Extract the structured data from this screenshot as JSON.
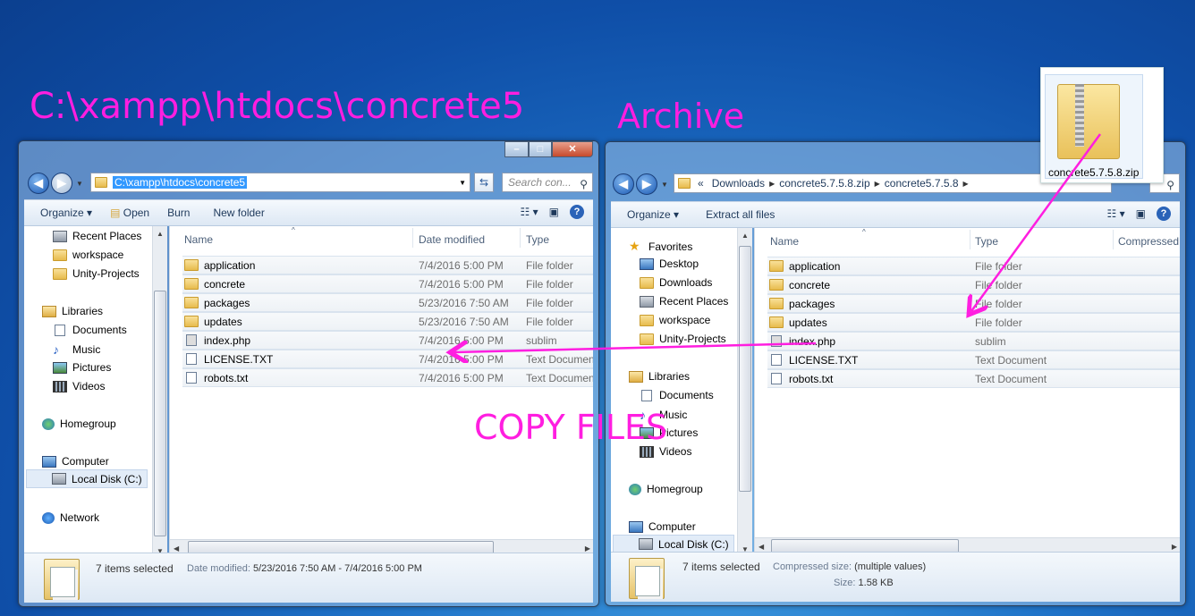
{
  "annotations": {
    "left_path": "C:\\xampp\\htdocs\\concrete5",
    "archive": "Archive",
    "copy_files": "COPY FILES"
  },
  "zip_desktop_icon": {
    "label": "concrete5.7.5.8.zip",
    "icon": "zip-folder-icon"
  },
  "left_window": {
    "address": "C:\\xampp\\htdocs\\concrete5",
    "search_placeholder": "Search con...",
    "toolbar": {
      "organize": "Organize",
      "open": "Open",
      "burn": "Burn",
      "new_folder": "New folder"
    },
    "nav": [
      {
        "label": "Recent Places",
        "icon": "recent-places-icon"
      },
      {
        "label": "workspace",
        "icon": "folder-icon"
      },
      {
        "label": "Unity-Projects",
        "icon": "folder-icon"
      },
      {
        "label": "Libraries",
        "icon": "libraries-icon"
      },
      {
        "label": "Documents",
        "icon": "documents-icon"
      },
      {
        "label": "Music",
        "icon": "music-icon"
      },
      {
        "label": "Pictures",
        "icon": "pictures-icon"
      },
      {
        "label": "Videos",
        "icon": "videos-icon"
      },
      {
        "label": "Homegroup",
        "icon": "homegroup-icon"
      },
      {
        "label": "Computer",
        "icon": "computer-icon"
      },
      {
        "label": "Local Disk (C:)",
        "icon": "local-disk-icon"
      },
      {
        "label": "Network",
        "icon": "network-icon"
      }
    ],
    "columns": {
      "name": "Name",
      "date": "Date modified",
      "type": "Type"
    },
    "files": [
      {
        "name": "application",
        "date": "7/4/2016 5:00 PM",
        "type": "File folder"
      },
      {
        "name": "concrete",
        "date": "7/4/2016 5:00 PM",
        "type": "File folder"
      },
      {
        "name": "packages",
        "date": "5/23/2016 7:50 AM",
        "type": "File folder"
      },
      {
        "name": "updates",
        "date": "5/23/2016 7:50 AM",
        "type": "File folder"
      },
      {
        "name": "index.php",
        "date": "7/4/2016 5:00 PM",
        "type": "sublim"
      },
      {
        "name": "LICENSE.TXT",
        "date": "7/4/2016 5:00 PM",
        "type": "Text Documen"
      },
      {
        "name": "robots.txt",
        "date": "7/4/2016 5:00 PM",
        "type": "Text Documen"
      }
    ],
    "status": {
      "selected": "7 items selected",
      "date_label": "Date modified:",
      "date_value": "5/23/2016 7:50 AM - 7/4/2016 5:00 PM"
    }
  },
  "right_window": {
    "breadcrumb": [
      "«",
      "Downloads",
      "concrete5.7.5.8.zip",
      "concrete5.7.5.8"
    ],
    "toolbar": {
      "organize": "Organize",
      "extract": "Extract all files"
    },
    "nav": [
      {
        "label": "Favorites",
        "icon": "favorites-star-icon"
      },
      {
        "label": "Desktop",
        "icon": "desktop-icon"
      },
      {
        "label": "Downloads",
        "icon": "downloads-icon"
      },
      {
        "label": "Recent Places",
        "icon": "recent-places-icon"
      },
      {
        "label": "workspace",
        "icon": "folder-icon"
      },
      {
        "label": "Unity-Projects",
        "icon": "folder-icon"
      },
      {
        "label": "Libraries",
        "icon": "libraries-icon"
      },
      {
        "label": "Documents",
        "icon": "documents-icon"
      },
      {
        "label": "Music",
        "icon": "music-icon"
      },
      {
        "label": "Pictures",
        "icon": "pictures-icon"
      },
      {
        "label": "Videos",
        "icon": "videos-icon"
      },
      {
        "label": "Homegroup",
        "icon": "homegroup-icon"
      },
      {
        "label": "Computer",
        "icon": "computer-icon"
      },
      {
        "label": "Local Disk (C:)",
        "icon": "local-disk-icon"
      }
    ],
    "columns": {
      "name": "Name",
      "type": "Type",
      "compressed": "Compressed"
    },
    "files": [
      {
        "name": "application",
        "type": "File folder"
      },
      {
        "name": "concrete",
        "type": "File folder"
      },
      {
        "name": "packages",
        "type": "File folder"
      },
      {
        "name": "updates",
        "type": "File folder"
      },
      {
        "name": "index.php",
        "type": "sublim"
      },
      {
        "name": "LICENSE.TXT",
        "type": "Text Document"
      },
      {
        "name": "robots.txt",
        "type": "Text Document"
      }
    ],
    "status": {
      "selected": "7 items selected",
      "csize_label": "Compressed size:",
      "csize_value": "(multiple values)",
      "size_label": "Size:",
      "size_value": "1.58 KB"
    }
  },
  "colors": {
    "annotation": "#ff1ee0",
    "selection": "#3399ff"
  }
}
